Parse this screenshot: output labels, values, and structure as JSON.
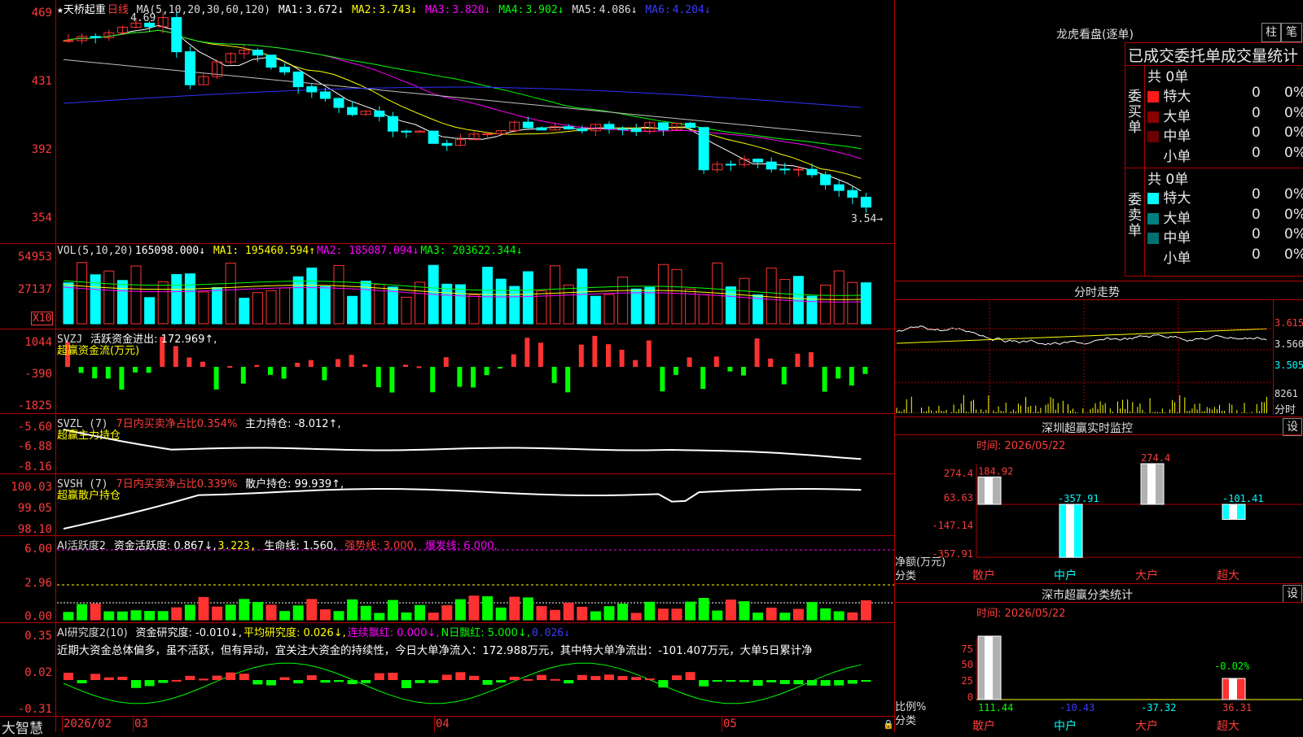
{
  "colors": {
    "up": "#ff3232",
    "down": "#00ffff",
    "ma1": "#ffffff",
    "ma2": "#ffff00",
    "ma3": "#ff00ff",
    "ma4": "#00ff00",
    "ma5": "#c0c0c0",
    "ma6": "#3030ff",
    "grid": "#b00000"
  },
  "kline": {
    "name": "★天桥起重",
    "period": "日线",
    "ma_label": "MA(5,10,20,30,60,120)",
    "ma": [
      {
        "label": "MA1:",
        "value": "3.672↓"
      },
      {
        "label": "MA2:",
        "value": "3.743↓"
      },
      {
        "label": "MA3:",
        "value": "3.820↓"
      },
      {
        "label": "MA4:",
        "value": "3.902↓"
      },
      {
        "label": "MA5:",
        "value": "4.086↓"
      },
      {
        "label": "MA6:",
        "value": "4.204↓"
      }
    ],
    "yticks": [
      "469",
      "431",
      "392",
      "354"
    ],
    "high_mark": "4.69",
    "low_mark": "3.54→"
  },
  "vol": {
    "label": "VOL(5,10,20)",
    "value": "165098.000↓",
    "ma1": "MA1: 195460.594↑",
    "ma2": "MA2: 185087.094↓",
    "ma3": "MA3: 203622.344↓",
    "yticks": [
      "54953",
      "27137"
    ],
    "unit": "X10"
  },
  "svzj": {
    "label": "SVZJ",
    "text": "活跃资金进出: 172.969↑,",
    "sub": "超赢资金流(万元)",
    "yticks": [
      "1044",
      "-390",
      "-1825"
    ]
  },
  "svzl": {
    "label": "SVZL (7)",
    "red": "7日内买卖净占比0.354%",
    "text": "主力持仓: -8.012↑,",
    "sub": "超赢主力持仓",
    "yticks": [
      "-5.60",
      "-6.88",
      "-8.16"
    ]
  },
  "svsh": {
    "label": "SVSH (7)",
    "red": "7日内买卖净占比0.339%",
    "text": "散户持仓: 99.939↑,",
    "sub": "超赢散户持仓",
    "yticks": [
      "100.03",
      "99.05",
      "98.10"
    ]
  },
  "ai1": {
    "label": "AI活跃度2",
    "a": "资金活跃度: 0.867↓,",
    "b": "3.223,",
    "c": "生命线: 1.560,",
    "d": "强势线: 3.000,",
    "e": "爆发线: 6.000,",
    "yticks": [
      "6.00",
      "2.96",
      "0.00"
    ]
  },
  "ai2": {
    "label": "AI研究度2(10)",
    "a": "资金研究度: -0.010↓,",
    "b": "平均研究度: 0.026↓,",
    "c": "连续飘红: 0.000↓,",
    "d": "N日飘红: 5.000↓,",
    "e": "0.026↓",
    "note": "近期大资金总体偏多，虽不活跃，但有异动，宜关注大资金的持续性，今日大单净流入：172.988万元，其中特大单净流出：-101.407万元，大单5日累计净",
    "yticks": [
      "0.35",
      "0.02",
      "-0.31"
    ]
  },
  "xaxis": {
    "brand": "大智慧",
    "labels": [
      "2026/02",
      "03",
      "04",
      "05"
    ]
  },
  "dragon": {
    "title": "龙虎看盘(逐单)",
    "btn1": "柱",
    "btn2": "笔",
    "stat_title": "已成交委托单成交量统计",
    "buy": {
      "side": "委买单",
      "total": "共 0单",
      "rows": [
        {
          "name": "特大",
          "v": "0",
          "p": "0%",
          "c": "#ff1a1a"
        },
        {
          "name": "大单",
          "v": "0",
          "p": "0%",
          "c": "#8a0000"
        },
        {
          "name": "中单",
          "v": "0",
          "p": "0%",
          "c": "#6a0000"
        },
        {
          "name": "小单",
          "v": "0",
          "p": "0%",
          "c": "#000000"
        }
      ]
    },
    "sell": {
      "side": "委卖单",
      "total": "共 0单",
      "rows": [
        {
          "name": "特大",
          "v": "0",
          "p": "0%",
          "c": "#00ffff"
        },
        {
          "name": "大单",
          "v": "0",
          "p": "0%",
          "c": "#008080"
        },
        {
          "name": "中单",
          "v": "0",
          "p": "0%",
          "c": "#007070"
        },
        {
          "name": "小单",
          "v": "0",
          "p": "0%",
          "c": "#000000"
        }
      ]
    }
  },
  "intraday": {
    "title": "分时走势",
    "yticks": [
      "3.615",
      "3.560",
      "3.505"
    ],
    "vol": "8261",
    "unit": "分时"
  },
  "monitor": {
    "title": "深圳超赢实时监控",
    "set": "设",
    "time": "时间: 2026/05/22",
    "yticks": [
      "274.4",
      "63.63",
      "-147.14",
      "-357.91"
    ],
    "bars": [
      {
        "cat": "散户",
        "v": "184.92"
      },
      {
        "cat": "中户",
        "v": "-357.91"
      },
      {
        "cat": "大户",
        "v": "274.4"
      },
      {
        "cat": "超大",
        "v": "-101.41"
      }
    ],
    "ylabel": "净额(万元)",
    "xlabel": "分类"
  },
  "classify": {
    "title": "深市超赢分类统计",
    "set": "设",
    "time": "时间: 2026/05/22",
    "yticks": [
      "75",
      "50",
      "25",
      "0"
    ],
    "bars": [
      {
        "cat": "散户",
        "v": "111.44"
      },
      {
        "cat": "中户",
        "v": "-10.43"
      },
      {
        "cat": "大户",
        "v": "-37.32"
      },
      {
        "cat": "超大",
        "v": "36.31"
      }
    ],
    "mark": "-0.02%",
    "ylabel": "比例%",
    "xlabel": "分类"
  }
}
